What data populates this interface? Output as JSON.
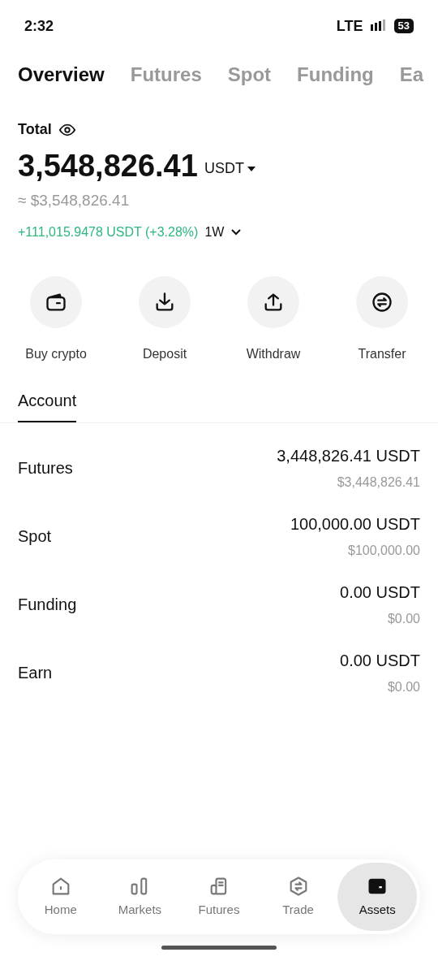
{
  "status_bar": {
    "time": "2:32",
    "network": "LTE",
    "battery": "53"
  },
  "tabs": [
    {
      "label": "Overview",
      "selected": true
    },
    {
      "label": "Futures",
      "selected": false
    },
    {
      "label": "Spot",
      "selected": false
    },
    {
      "label": "Funding",
      "selected": false
    },
    {
      "label": "Ea",
      "selected": false
    }
  ],
  "total": {
    "label": "Total",
    "amount": "3,548,826.41",
    "currency": "USDT",
    "approx": "≈ $3,548,826.41",
    "change": "+111,015.9478 USDT (+3.28%)",
    "period": "1W"
  },
  "actions": [
    {
      "kind": "buy",
      "label": "Buy crypto"
    },
    {
      "kind": "deposit",
      "label": "Deposit"
    },
    {
      "kind": "withdraw",
      "label": "Withdraw"
    },
    {
      "kind": "transfer",
      "label": "Transfer"
    }
  ],
  "section_tabs": [
    {
      "label": "Account",
      "selected": true
    }
  ],
  "accounts": [
    {
      "name": "Futures",
      "amount": "3,448,826.41 USDT",
      "usd": "$3,448,826.41"
    },
    {
      "name": "Spot",
      "amount": "100,000.00 USDT",
      "usd": "$100,000.00"
    },
    {
      "name": "Funding",
      "amount": "0.00 USDT",
      "usd": "$0.00"
    },
    {
      "name": "Earn",
      "amount": "0.00 USDT",
      "usd": "$0.00"
    }
  ],
  "nav": [
    {
      "kind": "home",
      "label": "Home",
      "selected": false
    },
    {
      "kind": "markets",
      "label": "Markets",
      "selected": false
    },
    {
      "kind": "futures",
      "label": "Futures",
      "selected": false
    },
    {
      "kind": "trade",
      "label": "Trade",
      "selected": false
    },
    {
      "kind": "assets",
      "label": "Assets",
      "selected": true
    }
  ]
}
